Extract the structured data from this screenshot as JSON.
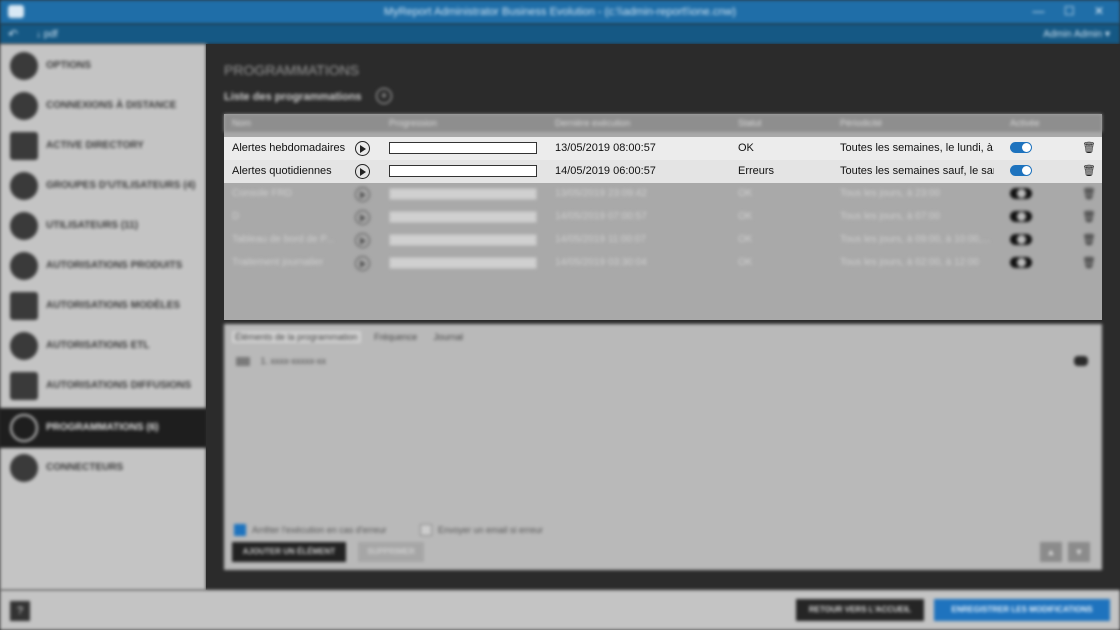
{
  "window": {
    "title": "MyReport Administrator Business Evolution - (c:\\\\admin-report\\\\one.cnw)",
    "controls": "— ☐ ✕"
  },
  "nav": {
    "back": "↶",
    "path": "↓ pdf",
    "user": "Admin Admin ▾"
  },
  "sidebar": {
    "items": [
      {
        "label": "OPTIONS",
        "icon": "gear-icon"
      },
      {
        "label": "CONNEXIONS À DISTANCE",
        "icon": "cloud-icon"
      },
      {
        "label": "ACTIVE DIRECTORY",
        "icon": "directory-icon"
      },
      {
        "label": "GROUPES D'UTILISATEURS (4)",
        "icon": "users-group-icon"
      },
      {
        "label": "UTILISATEURS (11)",
        "icon": "user-icon"
      },
      {
        "label": "AUTORISATIONS PRODUITS",
        "icon": "key-icon"
      },
      {
        "label": "AUTORISATIONS MODÈLES",
        "icon": "lock-icon"
      },
      {
        "label": "AUTORISATIONS ETL",
        "icon": "play-icon"
      },
      {
        "label": "AUTORISATIONS DIFFUSIONS",
        "icon": "mail-icon"
      },
      {
        "label": "PROGRAMMATIONS (6)",
        "icon": "clock-icon"
      },
      {
        "label": "CONNECTEURS",
        "icon": "plug-icon"
      }
    ]
  },
  "main": {
    "title": "PROGRAMMATIONS",
    "list_title": "Liste des programmations",
    "add_label": "+",
    "columns": [
      "Nom",
      "Progression",
      "Dernière exécution",
      "Statut",
      "Périodicité",
      "Activée"
    ],
    "rows": [
      {
        "name": "Alertes hebdomadaires",
        "last_run": "13/05/2019 08:00:57",
        "status": "OK",
        "periodicity": "Toutes les semaines, le lundi, à...",
        "enabled": true
      },
      {
        "name": "Alertes quotidiennes",
        "last_run": "14/05/2019 06:00:57",
        "status": "Erreurs",
        "periodicity": "Toutes les semaines sauf, le sam...",
        "enabled": true
      },
      {
        "name": "Console FRD",
        "last_run": "13/05/2019 23:09:42",
        "status": "OK",
        "periodicity": "Tous les jours, à 23:00",
        "enabled": false
      },
      {
        "name": "D",
        "last_run": "14/05/2019 07:00:57",
        "status": "OK",
        "periodicity": "Tous les jours, à 07:00",
        "enabled": false
      },
      {
        "name": "Tableau de bord de P...",
        "last_run": "14/05/2019 11:00:07",
        "status": "OK",
        "periodicity": "Tous les jours, à 09:00, à 10:00,...",
        "enabled": false
      },
      {
        "name": "Traitement journalier",
        "last_run": "14/05/2019 03:30:04",
        "status": "OK",
        "periodicity": "Tous les jours, à 02:00, à 12:00",
        "enabled": false
      }
    ]
  },
  "detail": {
    "tabs": [
      "Éléments de la programmation",
      "Fréquence",
      "Journal"
    ],
    "item": "1. xxxx-xxxxx-xx",
    "stop_on_error": "Arrêter l'exécution en cas d'erreur",
    "send_email": "Envoyer un email si erreur",
    "add_item": "AJOUTER UN ÉLÉMENT",
    "delete": "SUPPRIMER",
    "up": "▲",
    "down": "▼"
  },
  "footer": {
    "help": "?",
    "back": "RETOUR VERS L'ACCUEIL",
    "save": "ENREGISTRER LES MODIFICATIONS"
  }
}
